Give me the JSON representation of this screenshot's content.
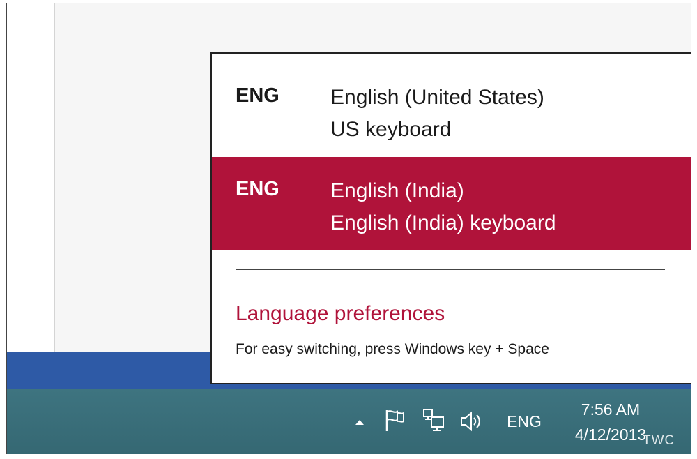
{
  "flyout": {
    "languages": [
      {
        "code": "ENG",
        "language": "English (United States)",
        "keyboard": "US keyboard",
        "selected": false
      },
      {
        "code": "ENG",
        "language": "English (India)",
        "keyboard": "English (India) keyboard",
        "selected": true
      }
    ],
    "preferences_link": "Language preferences",
    "hint": "For easy switching, press Windows key + Space"
  },
  "taskbar": {
    "icons": [
      "chevron-up-icon",
      "flag-icon",
      "network-icon",
      "speaker-icon"
    ],
    "input_indicator": "ENG",
    "time": "7:56 AM",
    "date": "4/12/2013"
  },
  "watermark": "TWC",
  "colors": {
    "accent": "#b0133a",
    "taskbar": "#3a6f7a",
    "app_bar": "#2e5aa6"
  }
}
